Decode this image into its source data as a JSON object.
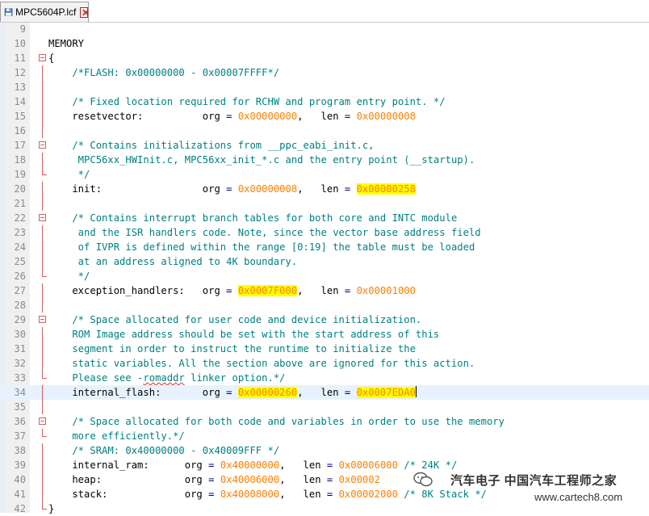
{
  "tab": {
    "label": "MPC5604P.lcf",
    "file_icon": "floppy-disk-icon",
    "close_icon": "close-icon"
  },
  "colors": {
    "comment": "#008080",
    "number": "#ff8000",
    "operator": "#000080",
    "highlight": "#ffff00",
    "current_line": "#e8f2ff"
  },
  "editor": {
    "lines": [
      {
        "n": "9",
        "parts": []
      },
      {
        "n": "10",
        "parts": [
          {
            "t": "MEMORY",
            "s": "p"
          }
        ]
      },
      {
        "n": "11",
        "fold": "open",
        "parts": [
          {
            "t": "{",
            "s": "p"
          }
        ]
      },
      {
        "n": "12",
        "fold": "line",
        "parts": [
          {
            "t": "    /*FLASH: 0x00000000 - 0x00007FFFF*/",
            "s": "c"
          }
        ]
      },
      {
        "n": "13",
        "fold": "line",
        "parts": []
      },
      {
        "n": "14",
        "fold": "line",
        "parts": [
          {
            "t": "    /* Fixed location required for RCHW and program entry point. */",
            "s": "c"
          }
        ]
      },
      {
        "n": "15",
        "fold": "line",
        "parts": [
          {
            "t": "    resetvector:          org ",
            "s": "p"
          },
          {
            "t": "=",
            "s": "op"
          },
          {
            "t": " ",
            "s": "p"
          },
          {
            "t": "0x00000000",
            "s": "o"
          },
          {
            "t": ",   len ",
            "s": "p"
          },
          {
            "t": "=",
            "s": "op"
          },
          {
            "t": " ",
            "s": "p"
          },
          {
            "t": "0x00000008",
            "s": "o"
          }
        ]
      },
      {
        "n": "16",
        "fold": "line",
        "parts": []
      },
      {
        "n": "17",
        "fold": "open",
        "parts": [
          {
            "t": "    /* Contains initializations from __ppc_eabi_init.c,",
            "s": "c"
          }
        ]
      },
      {
        "n": "18",
        "fold": "line",
        "parts": [
          {
            "t": "     MPC56xx_HWInit.c, MPC56xx_init_*.c and the entry point (__startup).",
            "s": "c"
          }
        ]
      },
      {
        "n": "19",
        "fold": "end",
        "parts": [
          {
            "t": "     */",
            "s": "c"
          }
        ]
      },
      {
        "n": "20",
        "fold": "line",
        "parts": [
          {
            "t": "    init:                 org ",
            "s": "p"
          },
          {
            "t": "=",
            "s": "op"
          },
          {
            "t": " ",
            "s": "p"
          },
          {
            "t": "0x00000008",
            "s": "o"
          },
          {
            "t": ",   len ",
            "s": "p"
          },
          {
            "t": "=",
            "s": "op"
          },
          {
            "t": " ",
            "s": "p"
          },
          {
            "t": "0x00000258",
            "s": "o",
            "hl": true
          }
        ]
      },
      {
        "n": "21",
        "fold": "line",
        "parts": []
      },
      {
        "n": "22",
        "fold": "open",
        "parts": [
          {
            "t": "    /* Contains interrupt branch tables for both core and INTC module",
            "s": "c"
          }
        ]
      },
      {
        "n": "23",
        "fold": "line",
        "parts": [
          {
            "t": "     and the ISR handlers code. Note, since the vector base address field",
            "s": "c"
          }
        ]
      },
      {
        "n": "24",
        "fold": "line",
        "parts": [
          {
            "t": "     of IVPR is defined within the range [0:19] the table must be loaded",
            "s": "c"
          }
        ]
      },
      {
        "n": "25",
        "fold": "line",
        "parts": [
          {
            "t": "     at an address aligned to 4K boundary.",
            "s": "c"
          }
        ]
      },
      {
        "n": "26",
        "fold": "end",
        "parts": [
          {
            "t": "     */",
            "s": "c"
          }
        ]
      },
      {
        "n": "27",
        "fold": "line",
        "parts": [
          {
            "t": "    exception_handlers:   org ",
            "s": "p"
          },
          {
            "t": "=",
            "s": "op"
          },
          {
            "t": " ",
            "s": "p"
          },
          {
            "t": "0x0007F000",
            "s": "o",
            "hl": true
          },
          {
            "t": ",   len ",
            "s": "p"
          },
          {
            "t": "=",
            "s": "op"
          },
          {
            "t": " ",
            "s": "p"
          },
          {
            "t": "0x00001000",
            "s": "o"
          }
        ]
      },
      {
        "n": "28",
        "fold": "line",
        "parts": []
      },
      {
        "n": "29",
        "fold": "open",
        "parts": [
          {
            "t": "    /* Space allocated for user code and device initialization.",
            "s": "c"
          }
        ]
      },
      {
        "n": "30",
        "fold": "line",
        "parts": [
          {
            "t": "    ROM Image address should be set with the start address of this",
            "s": "c"
          }
        ]
      },
      {
        "n": "31",
        "fold": "line",
        "parts": [
          {
            "t": "    segment in order to instruct the runtime to initialize the",
            "s": "c"
          }
        ]
      },
      {
        "n": "32",
        "fold": "line",
        "parts": [
          {
            "t": "    static variables. All the section above are ignored for this action.",
            "s": "c"
          }
        ]
      },
      {
        "n": "33",
        "fold": "end",
        "parts": [
          {
            "t": "    Please see -",
            "s": "c"
          },
          {
            "t": "romaddr",
            "s": "c",
            "squig": true
          },
          {
            "t": " linker option.*/",
            "s": "c"
          }
        ]
      },
      {
        "n": "34",
        "fold": "line",
        "current": true,
        "parts": [
          {
            "t": "    internal_flash:       org ",
            "s": "p"
          },
          {
            "t": "=",
            "s": "op"
          },
          {
            "t": " ",
            "s": "p"
          },
          {
            "t": "0x00000260",
            "s": "o",
            "hl": true
          },
          {
            "t": ",   len ",
            "s": "p"
          },
          {
            "t": "=",
            "s": "op"
          },
          {
            "t": " ",
            "s": "p"
          },
          {
            "t": "0x0007EDA0",
            "s": "o",
            "hl": true,
            "caret": true
          }
        ]
      },
      {
        "n": "35",
        "fold": "line",
        "parts": []
      },
      {
        "n": "36",
        "fold": "open",
        "parts": [
          {
            "t": "    /* Space allocated for both code and variables in order to use the memory",
            "s": "c"
          }
        ]
      },
      {
        "n": "37",
        "fold": "end",
        "parts": [
          {
            "t": "    more efficiently.*/",
            "s": "c"
          }
        ]
      },
      {
        "n": "38",
        "fold": "line",
        "parts": [
          {
            "t": "    /* SRAM: 0x40000000 - 0x40009FFF */",
            "s": "c"
          }
        ]
      },
      {
        "n": "39",
        "fold": "line",
        "parts": [
          {
            "t": "    internal_ram:      org ",
            "s": "p"
          },
          {
            "t": "=",
            "s": "op"
          },
          {
            "t": " ",
            "s": "p"
          },
          {
            "t": "0x40000000",
            "s": "o"
          },
          {
            "t": ",   len ",
            "s": "p"
          },
          {
            "t": "=",
            "s": "op"
          },
          {
            "t": " ",
            "s": "p"
          },
          {
            "t": "0x00006000",
            "s": "o"
          },
          {
            "t": " /* 24K */",
            "s": "c"
          }
        ]
      },
      {
        "n": "40",
        "fold": "line",
        "parts": [
          {
            "t": "    heap:              org ",
            "s": "p"
          },
          {
            "t": "=",
            "s": "op"
          },
          {
            "t": " ",
            "s": "p"
          },
          {
            "t": "0x40006000",
            "s": "o"
          },
          {
            "t": ",   len ",
            "s": "p"
          },
          {
            "t": "=",
            "s": "op"
          },
          {
            "t": " ",
            "s": "p"
          },
          {
            "t": "0x00002",
            "s": "o"
          }
        ]
      },
      {
        "n": "41",
        "fold": "line",
        "parts": [
          {
            "t": "    stack:             org ",
            "s": "p"
          },
          {
            "t": "=",
            "s": "op"
          },
          {
            "t": " ",
            "s": "p"
          },
          {
            "t": "0x40008000",
            "s": "o"
          },
          {
            "t": ",   len ",
            "s": "p"
          },
          {
            "t": "=",
            "s": "op"
          },
          {
            "t": " ",
            "s": "p"
          },
          {
            "t": "0x00002000",
            "s": "o"
          },
          {
            "t": " /* 8K Stack */",
            "s": "c"
          }
        ]
      },
      {
        "n": "42",
        "fold": "end",
        "parts": [
          {
            "t": "}",
            "s": "p"
          }
        ]
      }
    ]
  },
  "watermark": {
    "title": "汽车电子 中国汽车工程师之家",
    "url": "www.cartech8.com",
    "icon": "wechat-icon"
  }
}
